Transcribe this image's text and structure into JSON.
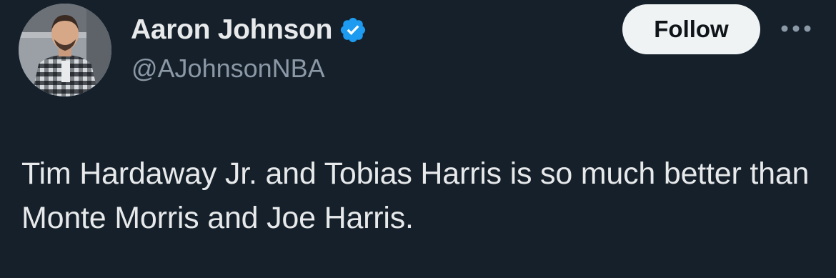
{
  "author": {
    "display_name": "Aaron Johnson",
    "handle": "@AJohnsonNBA",
    "verified": true,
    "avatar_icon": "profile-photo"
  },
  "actions": {
    "follow_label": "Follow",
    "more_icon": "more-horizontal-icon"
  },
  "tweet": {
    "text": "Tim Hardaway Jr. and Tobias Harris is so much better than Monte Morris and Joe Harris."
  },
  "colors": {
    "background": "#15202b",
    "primary_text": "#e7e9ea",
    "secondary_text": "#8b98a5",
    "verified_badge": "#1d9bf0",
    "follow_button_bg": "#eff3f4"
  }
}
